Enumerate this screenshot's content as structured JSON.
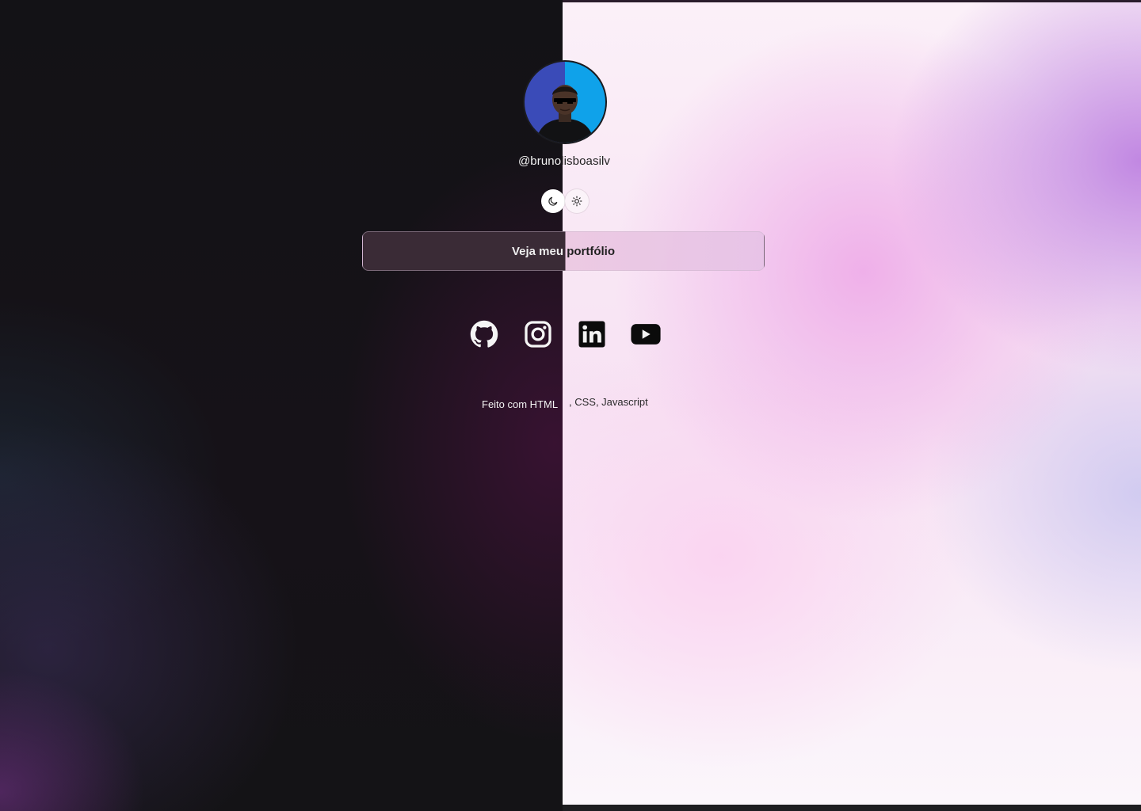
{
  "profile": {
    "handle_left": "@bruno",
    "handle_right": "lisboasilv",
    "avatar": "profile-photo"
  },
  "theme_toggle": {
    "dark_icon": "moon-icon",
    "light_icon": "sun-icon"
  },
  "portfolio_button": {
    "label": "Veja meu portfólio"
  },
  "socials": [
    {
      "name": "GitHub",
      "icon": "github-icon"
    },
    {
      "name": "Instagram",
      "icon": "instagram-icon"
    },
    {
      "name": "LinkedIn",
      "icon": "linkedin-icon"
    },
    {
      "name": "YouTube",
      "icon": "youtube-icon"
    }
  ],
  "footer": {
    "part_a": "Feito com HTML",
    "part_b": ", CSS, Javascript"
  },
  "colors": {
    "dark_bg": "#141316",
    "light_accent": "#c890e0",
    "avatar_left": "#3a4bb8",
    "avatar_right": "#0fa2ea"
  }
}
